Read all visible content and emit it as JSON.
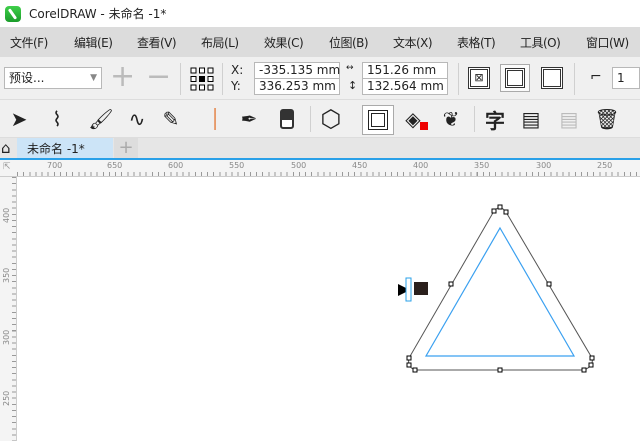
{
  "window": {
    "title": "CorelDRAW - 未命名 -1*"
  },
  "menu": [
    "文件(F)",
    "编辑(E)",
    "查看(V)",
    "布局(L)",
    "效果(C)",
    "位图(B)",
    "文本(X)",
    "表格(T)",
    "工具(O)",
    "窗口(W)"
  ],
  "property_bar": {
    "preset": "预设...",
    "x_label": "X:",
    "y_label": "Y:",
    "x": "-335.135 mm",
    "y": "336.253 mm",
    "width": "151.26 mm",
    "height": "132.564 mm",
    "steps": "1"
  },
  "tools": [
    "pick-tool",
    "shape-tool",
    "artistic-media-tool",
    "freehand-tool",
    "calligraphy-tool",
    "dimension-tool",
    "pen-tool",
    "eraser-tool",
    "polygon-tool",
    "contour-tool",
    "fill-tool",
    "smear-tool",
    "text-tool",
    "copy-properties",
    "paste",
    "delete"
  ],
  "tab": {
    "label": "未命名 -1*",
    "add": "+"
  },
  "rulers": {
    "horizontal": [
      "700",
      "650",
      "600",
      "550",
      "500",
      "450",
      "400",
      "350",
      "300",
      "250"
    ],
    "vertical": [
      "400",
      "350",
      "300",
      "250"
    ],
    "unit_icon": "mm"
  },
  "colors": {
    "accent": "#29a0e8",
    "contour": "#3aa0f0"
  }
}
